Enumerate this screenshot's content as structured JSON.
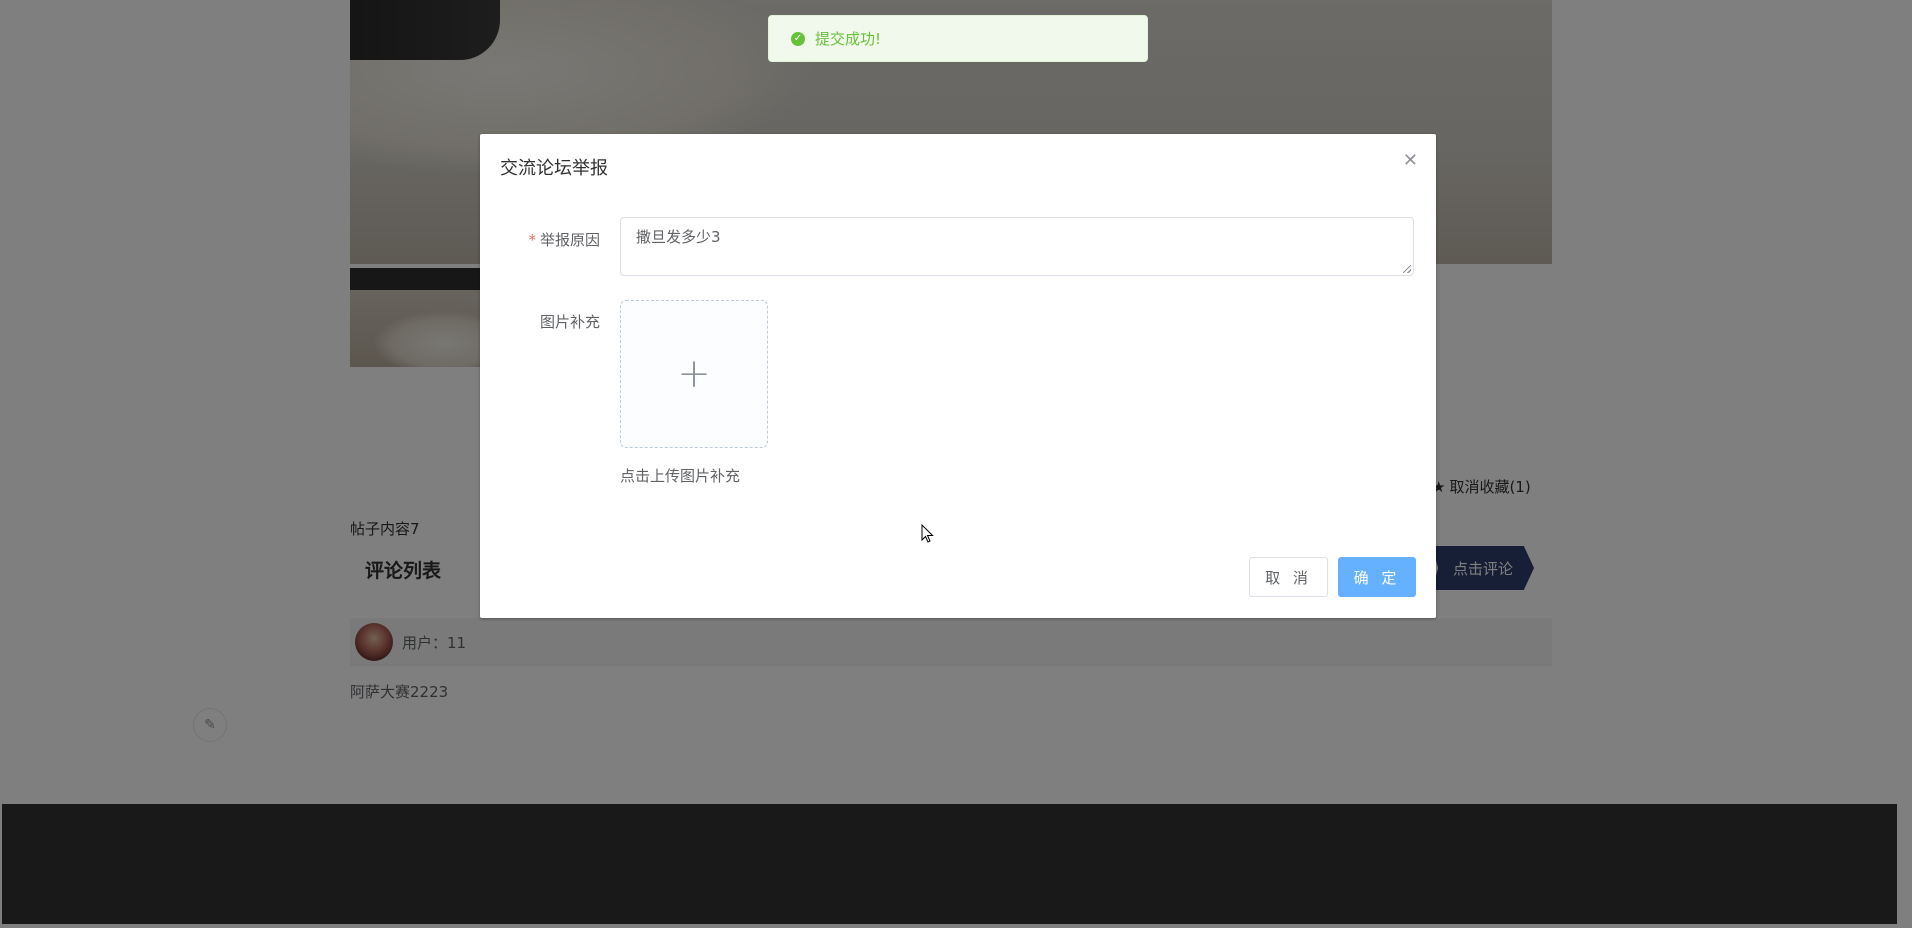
{
  "page": {
    "favorite_label": "取消收藏(1)",
    "post_content": "帖子内容7",
    "comment_section_title": "评论列表",
    "comment_button": "点击评论",
    "comment": {
      "user_label": "用户：11",
      "text": "阿萨大赛2223"
    }
  },
  "dialog": {
    "title": "交流论坛举报",
    "close_icon": "close-icon",
    "reason_label": "举报原因",
    "required_mark": "*",
    "reason_value": "撒旦发多少3",
    "image_label": "图片补充",
    "upload_icon": "plus-icon",
    "upload_tip": "点击上传图片补充",
    "cancel_label": "取 消",
    "confirm_label": "确 定"
  },
  "toast": {
    "icon": "success-check-icon",
    "message": "提交成功!"
  },
  "colors": {
    "primary_light": "#66b1ff",
    "success": "#67c23a",
    "danger": "#f56c6c",
    "comment_button": "#2c3e6b"
  }
}
